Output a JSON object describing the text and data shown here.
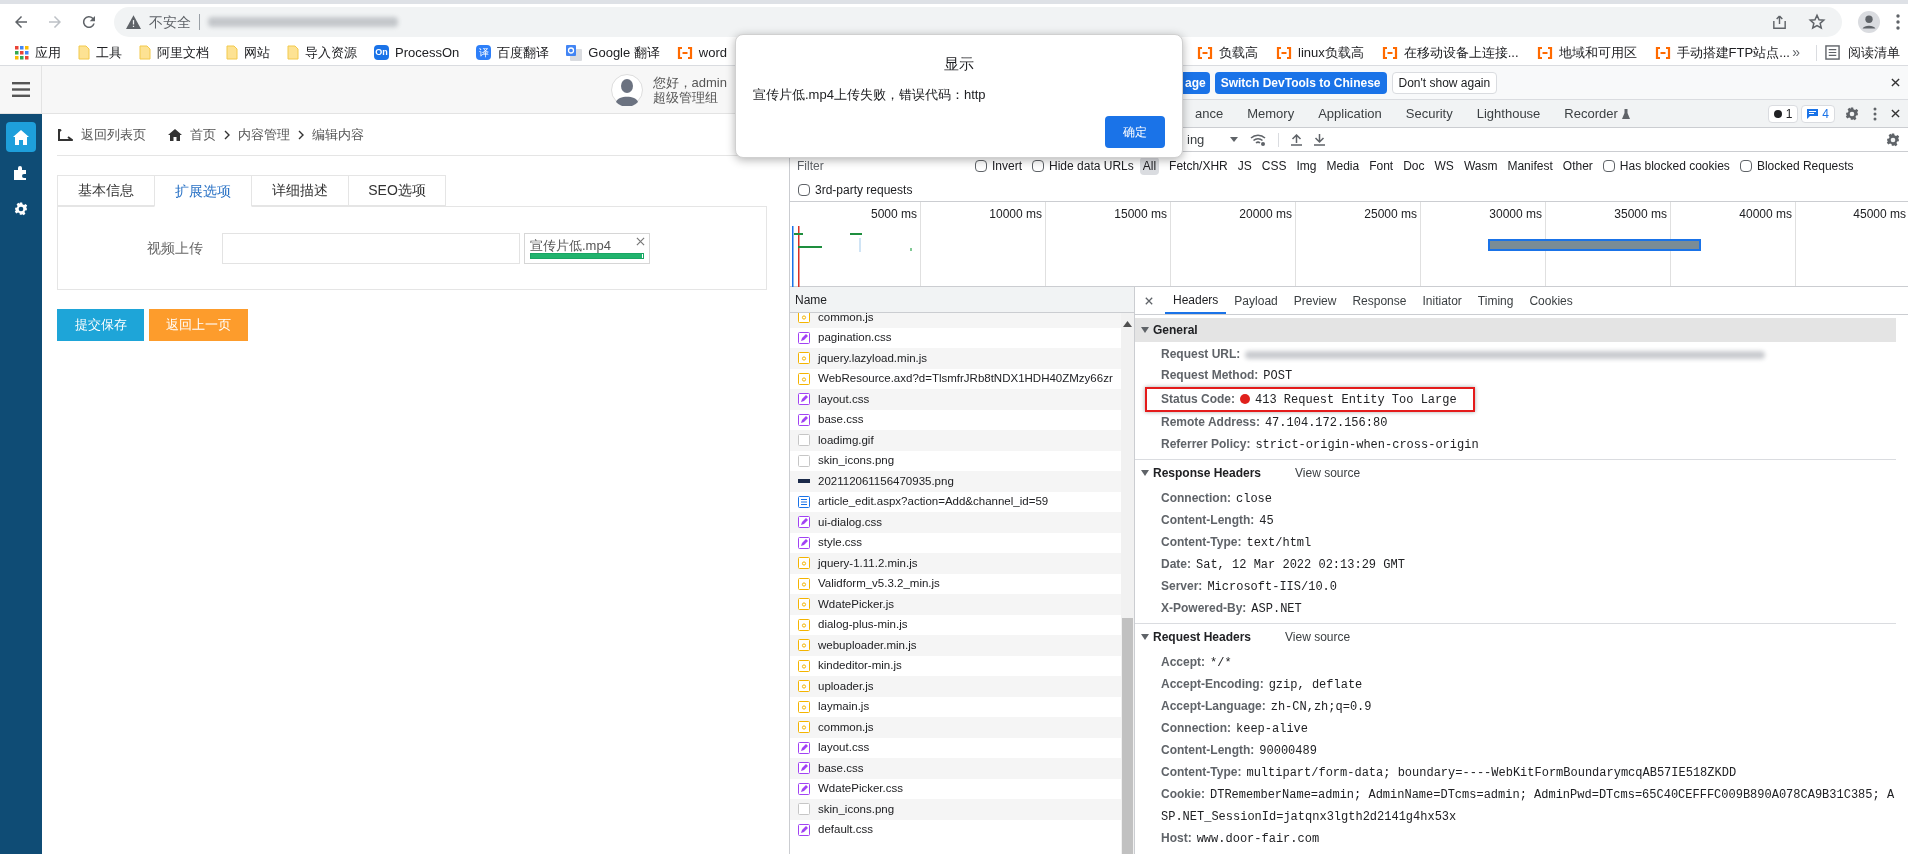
{
  "browser": {
    "insecure_label": "不安全",
    "bookmarks": [
      {
        "label": "应用",
        "kind": "apps"
      },
      {
        "label": "工具",
        "kind": "folder"
      },
      {
        "label": "阿里文档",
        "kind": "folder"
      },
      {
        "label": "网站",
        "kind": "folder"
      },
      {
        "label": "导入资源",
        "kind": "folder"
      },
      {
        "label": "ProcessOn",
        "kind": "processon",
        "logo_text": "On"
      },
      {
        "label": "百度翻译",
        "kind": "baidu",
        "logo_text": "译"
      },
      {
        "label": "Google 翻译",
        "kind": "google"
      },
      {
        "label": "word",
        "kind": "aliyun"
      }
    ],
    "bookmarks_right": [
      {
        "label": "负载高",
        "kind": "aliyun"
      },
      {
        "label": "linux负载高",
        "kind": "aliyun"
      },
      {
        "label": "在移动设备上连接...",
        "kind": "aliyun"
      },
      {
        "label": "地域和可用区",
        "kind": "aliyun"
      },
      {
        "label": "手动搭建FTP站点...",
        "kind": "aliyun"
      }
    ],
    "overflow": "»",
    "reading_list": "阅读清单"
  },
  "dialog": {
    "title": "显示",
    "message": "宣传片低.mp4上传失败，错误代码：http",
    "button": "确定"
  },
  "app": {
    "user": {
      "greeting": "您好，admin",
      "role": "超级管理组"
    },
    "nav": [
      {
        "kind": "home",
        "selected": true
      },
      {
        "kind": "puzzle",
        "selected": false
      },
      {
        "kind": "gear",
        "selected": false
      }
    ],
    "back_link": "返回列表页",
    "breadcrumb": [
      "首页",
      "内容管理",
      "编辑内容"
    ],
    "tabs": [
      {
        "label": "基本信息",
        "selected": false
      },
      {
        "label": "扩展选项",
        "selected": true
      },
      {
        "label": "详细描述",
        "selected": false
      },
      {
        "label": "SEO选项",
        "selected": false
      }
    ],
    "field": {
      "label": "视频上传",
      "file": {
        "name": "宣传片低.mp4",
        "level": 0.99
      }
    },
    "buttons": [
      {
        "label": "提交保存",
        "kind": "primary"
      },
      {
        "label": "返回上一页",
        "kind": "warning"
      }
    ]
  },
  "devtools": {
    "banner": {
      "partial_button": "age",
      "buttons": [
        {
          "label": "Switch DevTools to Chinese",
          "kind": "primary"
        },
        {
          "label": "Don't show again",
          "kind": "plain"
        }
      ]
    },
    "tabs": [
      {
        "label": "ance",
        "selected": false
      },
      {
        "label": "Memory",
        "selected": false
      },
      {
        "label": "Application",
        "selected": false
      },
      {
        "label": "Security",
        "selected": false
      },
      {
        "label": "Lighthouse",
        "selected": false
      },
      {
        "label": "Recorder",
        "selected": false
      }
    ],
    "errors": "1",
    "messages": "4",
    "throttling": "ing",
    "filter": {
      "placeholder": "Filter"
    },
    "checks": [
      {
        "label": "Invert",
        "checked": false
      },
      {
        "label": "Hide data URLs",
        "checked": false
      }
    ],
    "types": [
      {
        "label": "All",
        "selected": true
      },
      {
        "label": "Fetch/XHR",
        "selected": false
      },
      {
        "label": "JS",
        "selected": false
      },
      {
        "label": "CSS",
        "selected": false
      },
      {
        "label": "Img",
        "selected": false
      },
      {
        "label": "Media",
        "selected": false
      },
      {
        "label": "Font",
        "selected": false
      },
      {
        "label": "Doc",
        "selected": false
      },
      {
        "label": "WS",
        "selected": false
      },
      {
        "label": "Wasm",
        "selected": false
      },
      {
        "label": "Manifest",
        "selected": false
      },
      {
        "label": "Other",
        "selected": false
      }
    ],
    "checks_right": [
      {
        "label": "Has blocked cookies",
        "checked": false
      },
      {
        "label": "Blocked Requests",
        "checked": false
      }
    ],
    "third_party": {
      "label": "3rd-party requests",
      "checked": false
    },
    "timeline": {
      "ticks": [
        "5000 ms",
        "10000 ms",
        "15000 ms",
        "20000 ms",
        "25000 ms",
        "30000 ms",
        "35000 ms",
        "40000 ms",
        "45000 ms"
      ]
    },
    "requests": {
      "column": "Name",
      "rows": [
        {
          "name": "common.js",
          "kind": "script"
        },
        {
          "name": "pagination.css",
          "kind": "stylesheet"
        },
        {
          "name": "jquery.lazyload.min.js",
          "kind": "script"
        },
        {
          "name": "WebResource.axd?d=TlsmfrJRb8tNDX1HDH40ZMzy66zr",
          "kind": "script"
        },
        {
          "name": "layout.css",
          "kind": "stylesheet"
        },
        {
          "name": "base.css",
          "kind": "stylesheet"
        },
        {
          "name": "loadimg.gif",
          "kind": "image"
        },
        {
          "name": "skin_icons.png",
          "kind": "image"
        },
        {
          "name": "202112061156470935.png",
          "kind": "thumbnail"
        },
        {
          "name": "article_edit.aspx?action=Add&channel_id=59",
          "kind": "document"
        },
        {
          "name": "ui-dialog.css",
          "kind": "stylesheet"
        },
        {
          "name": "style.css",
          "kind": "stylesheet"
        },
        {
          "name": "jquery-1.11.2.min.js",
          "kind": "script"
        },
        {
          "name": "Validform_v5.3.2_min.js",
          "kind": "script"
        },
        {
          "name": "WdatePicker.js",
          "kind": "script"
        },
        {
          "name": "dialog-plus-min.js",
          "kind": "script"
        },
        {
          "name": "webuploader.min.js",
          "kind": "script"
        },
        {
          "name": "kindeditor-min.js",
          "kind": "script"
        },
        {
          "name": "uploader.js",
          "kind": "script"
        },
        {
          "name": "laymain.js",
          "kind": "script"
        },
        {
          "name": "common.js",
          "kind": "script"
        },
        {
          "name": "layout.css",
          "kind": "stylesheet"
        },
        {
          "name": "base.css",
          "kind": "stylesheet"
        },
        {
          "name": "WdatePicker.css",
          "kind": "stylesheet"
        },
        {
          "name": "skin_icons.png",
          "kind": "image"
        },
        {
          "name": "default.css",
          "kind": "stylesheet"
        }
      ]
    },
    "detail": {
      "tabs": [
        {
          "label": "Headers",
          "selected": true
        },
        {
          "label": "Payload",
          "selected": false
        },
        {
          "label": "Preview",
          "selected": false
        },
        {
          "label": "Response",
          "selected": false
        },
        {
          "label": "Initiator",
          "selected": false
        },
        {
          "label": "Timing",
          "selected": false
        },
        {
          "label": "Cookies",
          "selected": false
        }
      ],
      "sections": [
        {
          "title": "General",
          "expanded": true,
          "rows": [
            {
              "key": "Request URL:",
              "kind": "blurred"
            },
            {
              "key": "Request Method:",
              "value": "POST",
              "kind": "plain"
            },
            {
              "key": "Status Code:",
              "value": "413 Request Entity Too Large",
              "kind": "status",
              "highlighted": true
            },
            {
              "key": "Remote Address:",
              "value": "47.104.172.156:80",
              "kind": "plain"
            },
            {
              "key": "Referrer Policy:",
              "value": "strict-origin-when-cross-origin",
              "kind": "plain"
            }
          ]
        },
        {
          "title": "Response Headers",
          "action": "View source",
          "expanded": true,
          "rows": [
            {
              "key": "Connection:",
              "value": "close",
              "kind": "plain"
            },
            {
              "key": "Content-Length:",
              "value": "45",
              "kind": "plain"
            },
            {
              "key": "Content-Type:",
              "value": "text/html",
              "kind": "plain"
            },
            {
              "key": "Date:",
              "value": "Sat, 12 Mar 2022 02:13:29 GMT",
              "kind": "plain"
            },
            {
              "key": "Server:",
              "value": "Microsoft-IIS/10.0",
              "kind": "plain"
            },
            {
              "key": "X-Powered-By:",
              "value": "ASP.NET",
              "kind": "plain"
            }
          ]
        },
        {
          "title": "Request Headers",
          "action": "View source",
          "expanded": true,
          "rows": [
            {
              "key": "Accept:",
              "value": "*/*",
              "kind": "plain"
            },
            {
              "key": "Accept-Encoding:",
              "value": "gzip, deflate",
              "kind": "plain"
            },
            {
              "key": "Accept-Language:",
              "value": "zh-CN,zh;q=0.9",
              "kind": "plain"
            },
            {
              "key": "Connection:",
              "value": "keep-alive",
              "kind": "plain"
            },
            {
              "key": "Content-Length:",
              "value": "90000489",
              "kind": "plain"
            },
            {
              "key": "Content-Type:",
              "value": "multipart/form-data; boundary=----WebKitFormBoundarymcqAB57IE518ZKDD",
              "kind": "plain"
            },
            {
              "key": "Cookie:",
              "value": "DTRememberName=admin; AdminName=DTcms=admin; AdminPwd=DTcms=65C40CEFFFC009B890A078CA9B31C385; ASP.NET_SessionId=jatqnx3lgth2d2141g4hx53x",
              "kind": "plain"
            },
            {
              "key": "Host:",
              "value": "www.door-fair.com",
              "kind": "plain"
            }
          ]
        }
      ]
    }
  }
}
